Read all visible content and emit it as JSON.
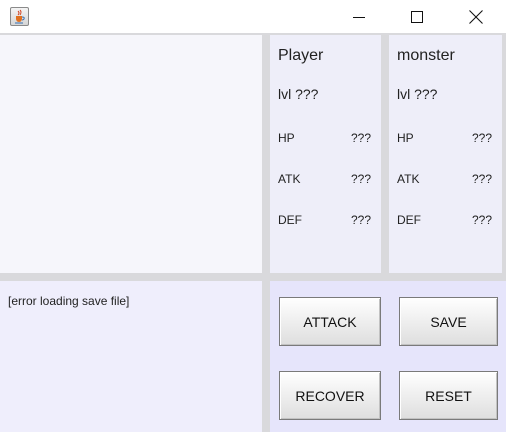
{
  "window": {
    "buttons": {
      "minimize": "minimize",
      "maximize": "maximize",
      "close": "close"
    }
  },
  "player": {
    "name": "Player",
    "level": "lvl ???",
    "stats": [
      {
        "label": "HP",
        "value": "???"
      },
      {
        "label": "ATK",
        "value": "???"
      },
      {
        "label": "DEF",
        "value": "???"
      }
    ]
  },
  "monster": {
    "name": "monster",
    "level": "lvl ???",
    "stats": [
      {
        "label": "HP",
        "value": "???"
      },
      {
        "label": "ATK",
        "value": "???"
      },
      {
        "label": "DEF",
        "value": "???"
      }
    ]
  },
  "log": {
    "text": "[error loading save file]"
  },
  "actions": {
    "attack": "ATTACK",
    "save": "SAVE",
    "recover": "RECOVER",
    "reset": "RESET"
  },
  "icons": {
    "app": "java-cup-icon",
    "minimize": "minimize-icon",
    "maximize": "maximize-icon",
    "close": "close-icon"
  }
}
